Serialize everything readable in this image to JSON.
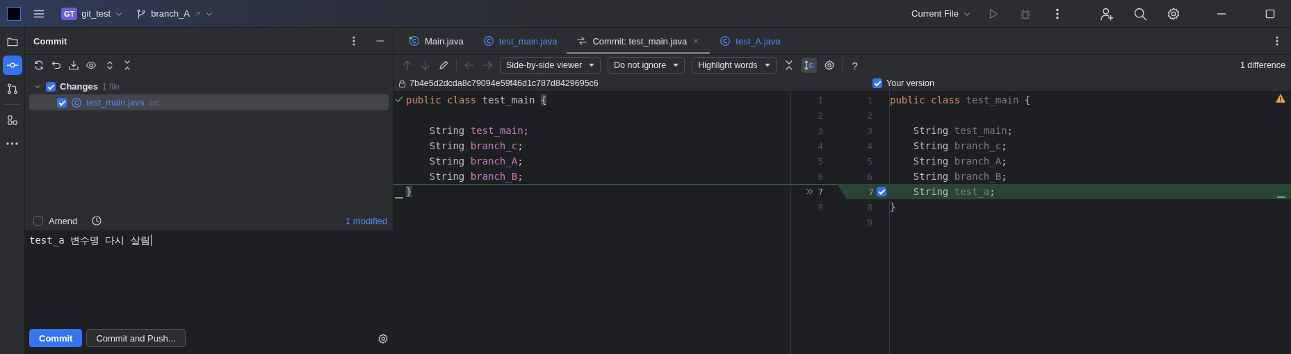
{
  "title_bar": {
    "project_badge": "GT",
    "project": "git_test",
    "branch": "branch_A",
    "run_config": "Current File"
  },
  "tool_strip": [
    {
      "kind": "folder",
      "selected": false
    },
    {
      "kind": "commit",
      "selected": true
    },
    {
      "kind": "pull_requests",
      "selected": false
    },
    {
      "kind": "structure",
      "selected": false
    },
    {
      "kind": "more",
      "selected": false
    }
  ],
  "commit_panel": {
    "title": "Commit",
    "changes": {
      "label": "Changes",
      "count": "1 file",
      "checked": true,
      "expanded": true,
      "children": [
        {
          "label": "test_main.java",
          "location": "src",
          "checked": true,
          "selected": true
        }
      ]
    },
    "amend": {
      "label": "Amend",
      "checked": false
    },
    "modified": "1 modified",
    "message": "test_a 변수명 다시 살림",
    "buttons": [
      {
        "label": "Commit",
        "kind": "primary"
      },
      {
        "label": "Commit and Push...",
        "kind": "secondary"
      }
    ]
  },
  "editor": {
    "tabs": [
      {
        "label": "Main.java",
        "kind": "runnable_class",
        "selected": false
      },
      {
        "label": "test_main.java",
        "kind": "class",
        "selected": false
      },
      {
        "label": "Commit: test_main.java",
        "kind": "diff",
        "selected": true
      },
      {
        "label": "test_A.java",
        "kind": "class",
        "selected": false
      }
    ],
    "toolbar": {
      "viewer": "Side-by-side viewer",
      "ignore": "Do not ignore",
      "highlight": "Highlight words",
      "sync_scroll_on": true,
      "help": "?",
      "differences": "1 difference"
    },
    "left": {
      "revision": "7b4e5d2dcda8c79094e59f46d1c787d8429695c6",
      "lines": [
        {
          "number": "1",
          "tokens": [
            {
              "text": "public class ",
              "kind": "keyword"
            },
            {
              "text": "test_main ",
              "kind": "plain"
            },
            {
              "text": "{",
              "kind": "brace"
            }
          ]
        },
        {
          "number": "2"
        },
        {
          "number": "3",
          "tokens": [
            {
              "text": "    String ",
              "kind": "plain"
            },
            {
              "text": "test_main",
              "kind": "field"
            },
            {
              "text": ";",
              "kind": "plain"
            }
          ]
        },
        {
          "number": "4",
          "tokens": [
            {
              "text": "    String ",
              "kind": "plain"
            },
            {
              "text": "branch_c",
              "kind": "field"
            },
            {
              "text": ";",
              "kind": "plain"
            }
          ]
        },
        {
          "number": "5",
          "tokens": [
            {
              "text": "    String ",
              "kind": "plain"
            },
            {
              "text": "branch_A",
              "kind": "field"
            },
            {
              "text": ";",
              "kind": "plain"
            }
          ]
        },
        {
          "number": "6",
          "tokens": [
            {
              "text": "    String ",
              "kind": "plain"
            },
            {
              "text": "branch_B",
              "kind": "field"
            },
            {
              "text": ";",
              "kind": "plain"
            }
          ]
        },
        {
          "number": "7",
          "insertion_above": true,
          "tokens": [
            {
              "text": "}",
              "kind": "brace"
            }
          ]
        },
        {
          "number": "8"
        }
      ]
    },
    "right": {
      "label": "Your version",
      "checked": true,
      "lines": [
        {
          "number": "1",
          "tokens": [
            {
              "text": "public class ",
              "kind": "keyword"
            },
            {
              "text": "test_main",
              "kind": "unused"
            },
            {
              "text": " {",
              "kind": "plain"
            }
          ]
        },
        {
          "number": "2"
        },
        {
          "number": "3",
          "tokens": [
            {
              "text": "    String ",
              "kind": "plain"
            },
            {
              "text": "test_main",
              "kind": "unused"
            },
            {
              "text": ";",
              "kind": "plain"
            }
          ]
        },
        {
          "number": "4",
          "tokens": [
            {
              "text": "    String ",
              "kind": "plain"
            },
            {
              "text": "branch_c",
              "kind": "unused"
            },
            {
              "text": ";",
              "kind": "plain"
            }
          ]
        },
        {
          "number": "5",
          "tokens": [
            {
              "text": "    String ",
              "kind": "plain"
            },
            {
              "text": "branch_A",
              "kind": "unused"
            },
            {
              "text": ";",
              "kind": "plain"
            }
          ]
        },
        {
          "number": "6",
          "tokens": [
            {
              "text": "    String ",
              "kind": "plain"
            },
            {
              "text": "branch_B",
              "kind": "unused"
            },
            {
              "text": ";",
              "kind": "plain"
            }
          ]
        },
        {
          "number": "7",
          "inserted": true,
          "included": true,
          "tokens": [
            {
              "text": "    String ",
              "kind": "plain"
            },
            {
              "text": "test_a",
              "kind": "unused"
            },
            {
              "text": ";",
              "kind": "plain"
            }
          ]
        },
        {
          "number": "8",
          "tokens": [
            {
              "text": "}",
              "kind": "plain"
            }
          ]
        },
        {
          "number": "9"
        }
      ]
    }
  }
}
